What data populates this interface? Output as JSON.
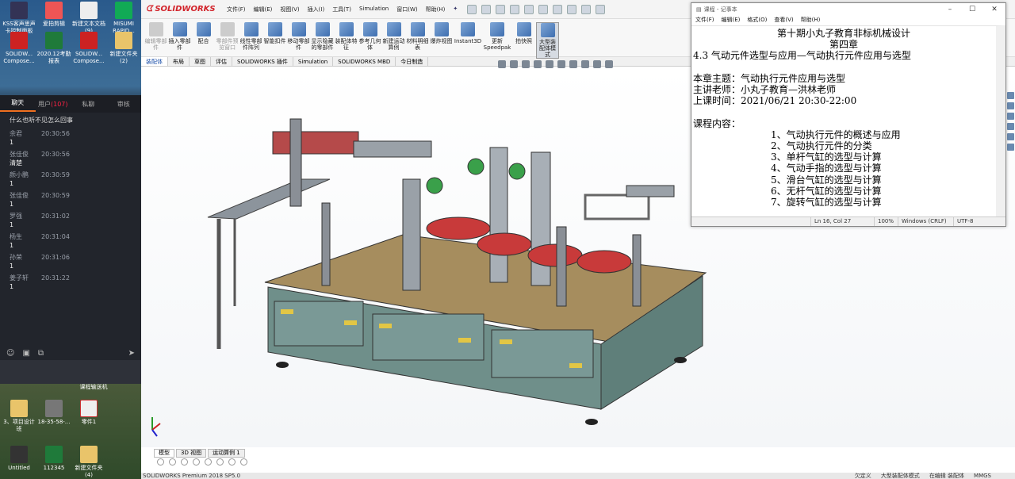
{
  "desktop": {
    "top_icons": [
      {
        "label": "KSS客声思声卡控制面板"
      },
      {
        "label": "爱拍剪辑"
      },
      {
        "label": "新建文本文档 (9)"
      },
      {
        "label": "MISUMI RAPID..."
      },
      {
        "label": "SOLIDW... Compose..."
      },
      {
        "label": "2020.12考勤报表"
      },
      {
        "label": "SOLIDW... Compose..."
      },
      {
        "label": "新建文件夹 (2)"
      }
    ],
    "bottom_icons": [
      {
        "label": "3、项目设计班"
      },
      {
        "label": "18-35-58-..."
      },
      {
        "label": "零件1"
      },
      {
        "label": "Untitled"
      },
      {
        "label": "112345"
      },
      {
        "label": "新建文件夹 (4)"
      }
    ],
    "stray_label": "课程输送机"
  },
  "chat": {
    "tabs": [
      {
        "label": "聊天"
      },
      {
        "label": "用户",
        "count": "(107)"
      },
      {
        "label": "私聊"
      },
      {
        "label": "审核"
      }
    ],
    "system_message": "什么也听不见怎么回事",
    "messages": [
      {
        "who": "余君",
        "time": "20:30:56",
        "body": "1"
      },
      {
        "who": "张佳俊",
        "time": "20:30:56",
        "body": "清楚"
      },
      {
        "who": "颜小鹏",
        "time": "20:30:59",
        "body": "1"
      },
      {
        "who": "张佳俊",
        "time": "20:30:59",
        "body": "1"
      },
      {
        "who": "罗强",
        "time": "20:31:02",
        "body": "1"
      },
      {
        "who": "杨生",
        "time": "20:31:04",
        "body": "1"
      },
      {
        "who": "孙荣",
        "time": "20:31:06",
        "body": "1"
      },
      {
        "who": "姜子轩",
        "time": "20:31:22",
        "body": "1"
      }
    ]
  },
  "solidworks": {
    "logo": "SOLIDWORKS",
    "menus": [
      "文件(F)",
      "编辑(E)",
      "视图(V)",
      "插入(I)",
      "工具(T)",
      "Simulation",
      "窗口(W)",
      "帮助(H)"
    ],
    "commands": [
      {
        "label": "编辑零部件",
        "disabled": true
      },
      {
        "label": "插入零部件",
        "disabled": false
      },
      {
        "label": "配合",
        "disabled": false
      },
      {
        "label": "零部件预览窗口",
        "disabled": true
      },
      {
        "label": "线性零部件阵列",
        "disabled": false
      },
      {
        "label": "智能扣件",
        "disabled": false
      },
      {
        "label": "移动零部件",
        "disabled": false
      },
      {
        "label": "显示隐藏的零部件",
        "disabled": false
      },
      {
        "label": "装配体特征",
        "disabled": false
      },
      {
        "label": "参考几何体",
        "disabled": false
      },
      {
        "label": "新建运动算例",
        "disabled": false
      },
      {
        "label": "材料明细表",
        "disabled": false
      },
      {
        "label": "爆炸视图",
        "disabled": false
      },
      {
        "label": "Instant3D",
        "disabled": false
      },
      {
        "label": "更新Speedpak",
        "disabled": false
      },
      {
        "label": "拍快照",
        "disabled": false
      },
      {
        "label": "大型装配体模式",
        "disabled": false,
        "active": true
      }
    ],
    "cmd_tabs": [
      "装配体",
      "布局",
      "草图",
      "评估",
      "SOLIDWORKS 插件",
      "Simulation",
      "SOLIDWORKS MBD",
      "今日制造"
    ],
    "model_tabs": [
      "模型",
      "3D 视图",
      "运动算例 1"
    ],
    "status_left": "SOLIDWORKS Premium 2018 SP5.0",
    "status_right": [
      "欠定义",
      "大型装配体模式",
      "在编辑 装配体",
      "MMGS"
    ]
  },
  "notepad": {
    "title": "课程 - 记事本",
    "menu": [
      "文件(F)",
      "编辑(E)",
      "格式(O)",
      "查看(V)",
      "帮助(H)"
    ],
    "lines": {
      "course": "第十期小丸子教育非标机械设计",
      "chapter": "第四章",
      "section": "4.3 气动元件选型与应用—气动执行元件应用与选型",
      "topic": "本章主题：气动执行元件应用与选型",
      "teacher": "主讲老师：小丸子教育—洪林老师",
      "time": "上课时间：2021/06/21  20:30-22:00",
      "content_label": "课程内容：",
      "items": [
        "1、气动执行元件的概述与应用",
        "2、气动执行元件的分类",
        "3、单杆气缸的选型与计算",
        "4、气动手指的选型与计算",
        "5、滑台气缸的选型与计算",
        "6、无杆气缸的选型与计算",
        "7、旋转气缸的选型与计算"
      ]
    },
    "status": {
      "pos": "Ln 16, Col 27",
      "zoom": "100%",
      "eol": "Windows (CRLF)",
      "enc": "UTF-8"
    }
  }
}
